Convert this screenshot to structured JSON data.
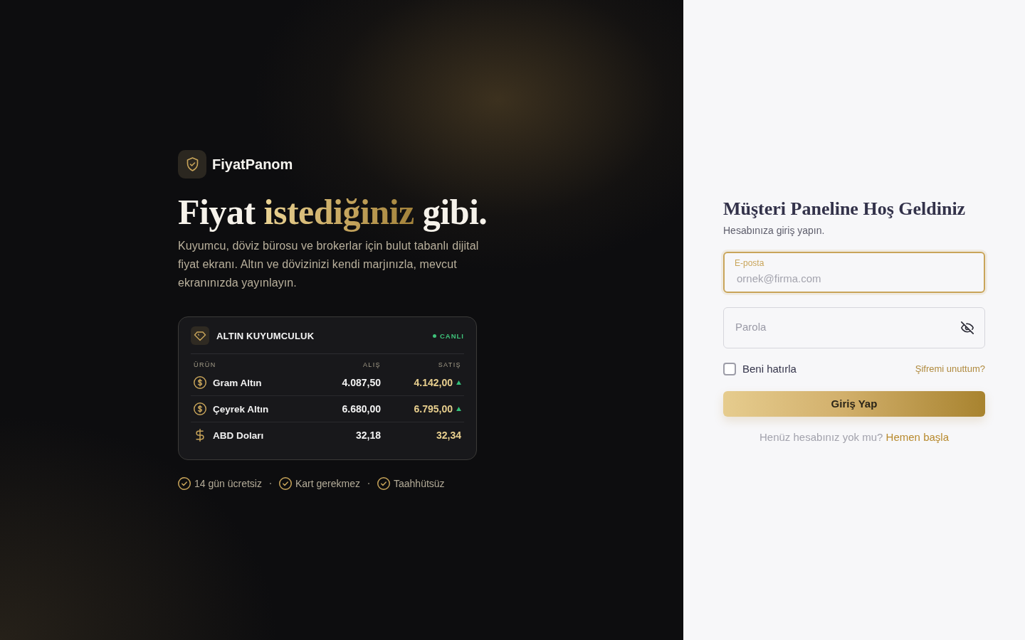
{
  "brand": {
    "name": "FiyatPanom"
  },
  "hero": {
    "headline": [
      {
        "text": "Fiyat",
        "kind": "plain"
      },
      {
        "text": "istediğiniz",
        "kind": "accent"
      },
      {
        "text": "gibi.",
        "kind": "plain"
      }
    ],
    "description": "Kuyumcu, döviz bürosu ve brokerlar için bulut tabanlı dijital fiyat ekranı. Altın ve dövizinizi kendi marjınızla, mevcut ekranınızda yayınlayın."
  },
  "price_card": {
    "title": "ALTIN KUYUMCULUK",
    "status": "CANLI",
    "columns": [
      "ÜRÜN",
      "ALIŞ",
      "SATIŞ"
    ],
    "rows": [
      {
        "kind": "coin",
        "product": "Gram Altın",
        "buy": "4.087,50",
        "sell": "4.142,00",
        "rising": true
      },
      {
        "kind": "coin",
        "product": "Çeyrek Altın",
        "buy": "6.680,00",
        "sell": "6.795,00",
        "rising": true
      },
      {
        "kind": "dollar",
        "product": "ABD Doları",
        "buy": "32,18",
        "sell": "32,34",
        "rising": false
      }
    ]
  },
  "features": [
    "14 gün ücretsiz",
    "Kart gerekmez",
    "Taahhütsüz"
  ],
  "login": {
    "title": "Müşteri Paneline Hoş Geldiniz",
    "subtitle": "Hesabınıza giriş yapın.",
    "fields": [
      {
        "kind": "email",
        "label": "E-posta",
        "placeholder": "ornek@firma.com",
        "focused": true
      },
      {
        "kind": "password",
        "placeholder": "Parola",
        "focused": false
      }
    ],
    "remember": {
      "label": "Beni hatırla",
      "checked": false
    },
    "forgot_link": "Şifremi unuttum?",
    "submit": "Giriş Yap",
    "signup": {
      "text": "Henüz hesabınız yok mu?",
      "link": "Hemen başla"
    }
  }
}
